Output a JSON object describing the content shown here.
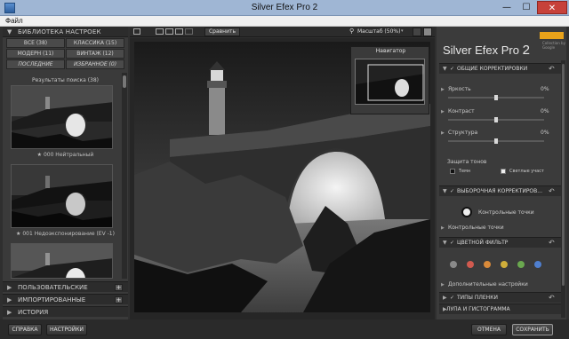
{
  "window": {
    "title": "Silver Efex Pro 2",
    "buttons": {
      "minimize": "—",
      "maximize": "☐",
      "close": "✕"
    }
  },
  "menu": {
    "items": [
      "Файл"
    ]
  },
  "library": {
    "header": "БИБЛИОТЕКА НАСТРОЕК",
    "filters": [
      {
        "label": "ВСЕ (38)"
      },
      {
        "label": "КЛАССИКА (15)"
      },
      {
        "label": "МОДЕРН (11)"
      },
      {
        "label": "ВИНТАЖ (12)"
      },
      {
        "label": "ПОСЛЕДНИЕ"
      },
      {
        "label": "ИЗБРАННОЕ (0)"
      }
    ],
    "results_label": "Результаты поиска (38)",
    "presets": [
      {
        "caption": "★ 000 Нейтральный"
      },
      {
        "caption": "★ 001 Недоэкспонирование (EV -1)"
      },
      {
        "caption": ""
      }
    ],
    "sections": [
      {
        "label": "ПОЛЬЗОВАТЕЛЬСКИЕ",
        "plus": "+"
      },
      {
        "label": "ИМПОРТИРОВАННЫЕ",
        "plus": "+"
      },
      {
        "label": "ИСТОРИЯ"
      }
    ]
  },
  "toolbar": {
    "compare_label": "Сравнить",
    "zoom_label": "Масштаб (50%)"
  },
  "navigator": {
    "title": "Навигатор"
  },
  "right": {
    "brand": "Silver Efex Pro",
    "brand_version": "2",
    "brand_sub": "Collection by Google",
    "global": {
      "label": "ОБЩИЕ КОРРЕКТИРОВКИ",
      "sliders": [
        {
          "label": "Яркость",
          "value": "0%",
          "fraction": 0.5
        },
        {
          "label": "Контраст",
          "value": "0%",
          "fraction": 0.5
        },
        {
          "label": "Структура",
          "value": "0%",
          "fraction": 0.5
        }
      ],
      "tone_label": "Защита тонов",
      "tone_dark": "Темн",
      "tone_light": "Светлые участ"
    },
    "selective": {
      "label": "ВЫБОРОЧНАЯ КОРРЕКТИРОВ...",
      "points_button": "Контрольные точки",
      "points_row": "Контрольные точки"
    },
    "color_filter": {
      "label": "ЦВЕТНОЙ ФИЛЬТР",
      "dots": [
        "#8a8a8a",
        "#d15a4f",
        "#d98a3a",
        "#cfae3a",
        "#6aa84f",
        "#4f7fcf"
      ],
      "extra": "Дополнительные настройки"
    },
    "film_label": "ТИПЫ ПЛЕНКИ",
    "loupe_label": "ЛУПА И ГИСТОГРАММА"
  },
  "bottom": {
    "help": "СПРАВКА",
    "settings": "НАСТРОЙКИ",
    "cancel": "ОТМЕНА",
    "save": "СОХРАНИТЬ"
  }
}
